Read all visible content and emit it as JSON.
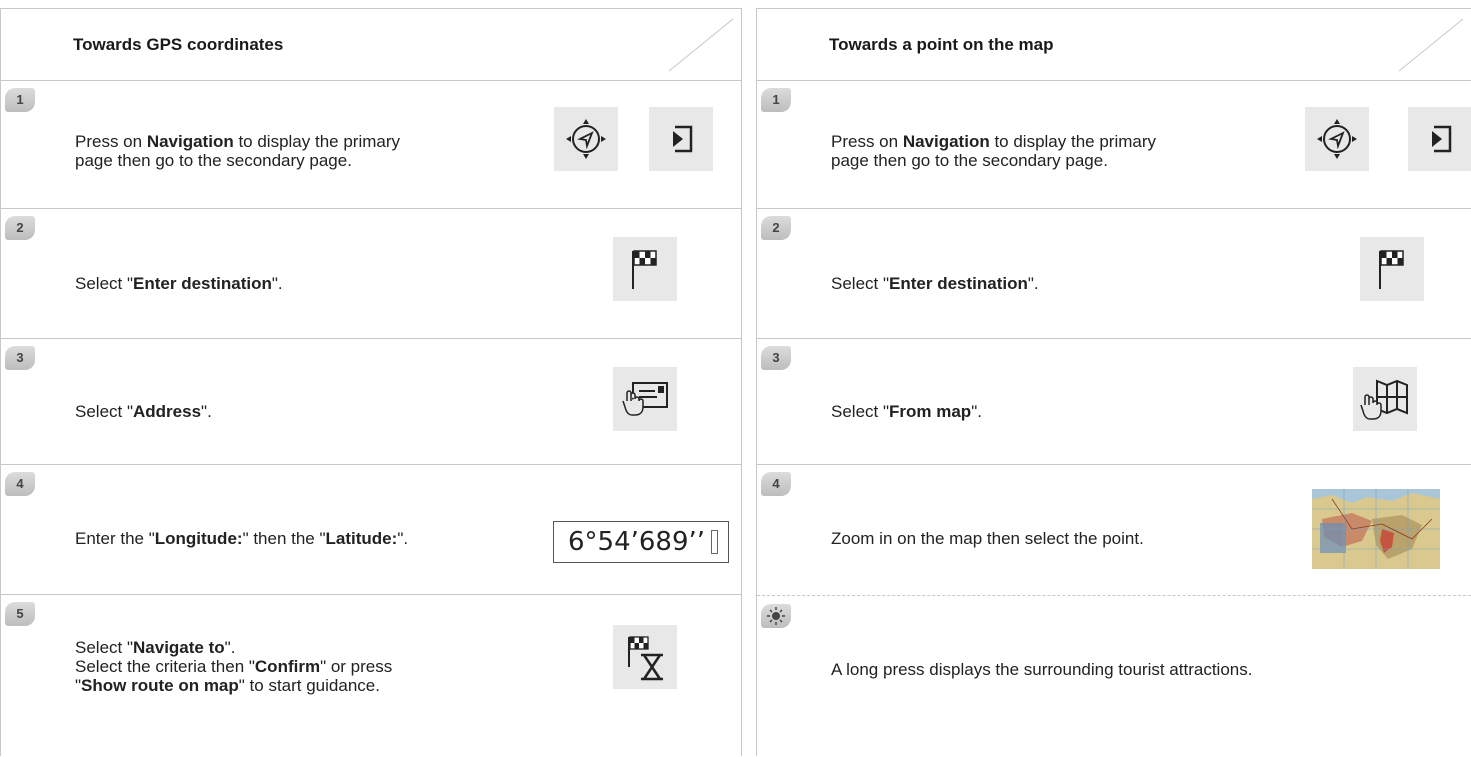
{
  "left": {
    "title": "Towards GPS coordinates",
    "steps": [
      {
        "num": "1",
        "pre": "Press on ",
        "bold": "Navigation",
        "post": " to display the primary",
        "line2": "page then go to the secondary page.",
        "icons": [
          "navigation-icon",
          "secondary-page-icon"
        ]
      },
      {
        "num": "2",
        "pre": "Select \"",
        "bold": "Enter destination",
        "post": "\".",
        "icons": [
          "destination-flag-icon"
        ]
      },
      {
        "num": "3",
        "pre": "Select \"",
        "bold": "Address",
        "post": "\".",
        "icons": [
          "address-card-icon"
        ]
      },
      {
        "num": "4",
        "pre": "Enter the \"",
        "bold": "Longitude:",
        "mid": "\" then the \"",
        "bold2": "Latitude:",
        "post": "\".",
        "coord": "6°54’689’’"
      },
      {
        "num": "5",
        "l1_pre": "Select \"",
        "l1_bold": "Navigate to",
        "l1_post": "\".",
        "l2_pre": "Select the criteria then \"",
        "l2_bold": "Confirm",
        "l2_post": "\" or press",
        "l3_pre": "\"",
        "l3_bold": "Show route on map",
        "l3_post": "\" to start guidance.",
        "icons": [
          "flag-hourglass-icon"
        ]
      }
    ]
  },
  "right": {
    "title": "Towards a point on the map",
    "steps": [
      {
        "num": "1",
        "pre": "Press on ",
        "bold": "Navigation",
        "post": " to display the primary",
        "line2": "page then go to the secondary page.",
        "icons": [
          "navigation-icon",
          "secondary-page-icon"
        ]
      },
      {
        "num": "2",
        "pre": "Select \"",
        "bold": "Enter destination",
        "post": "\".",
        "icons": [
          "destination-flag-icon"
        ]
      },
      {
        "num": "3",
        "pre": "Select \"",
        "bold": "From map",
        "post": "\".",
        "icons": [
          "from-map-icon"
        ]
      },
      {
        "num": "4",
        "text": "Zoom in on the map then select the point.",
        "icons": [
          "map-thumbnail"
        ]
      },
      {
        "tip": "A long press displays the surrounding tourist attractions.",
        "icons": [
          "tip-sun-icon"
        ]
      }
    ]
  },
  "colors": {
    "border": "#c8c8c8",
    "icon_bg": "#e8e8e8",
    "badge": "#c9c9c9",
    "text": "#222222"
  }
}
